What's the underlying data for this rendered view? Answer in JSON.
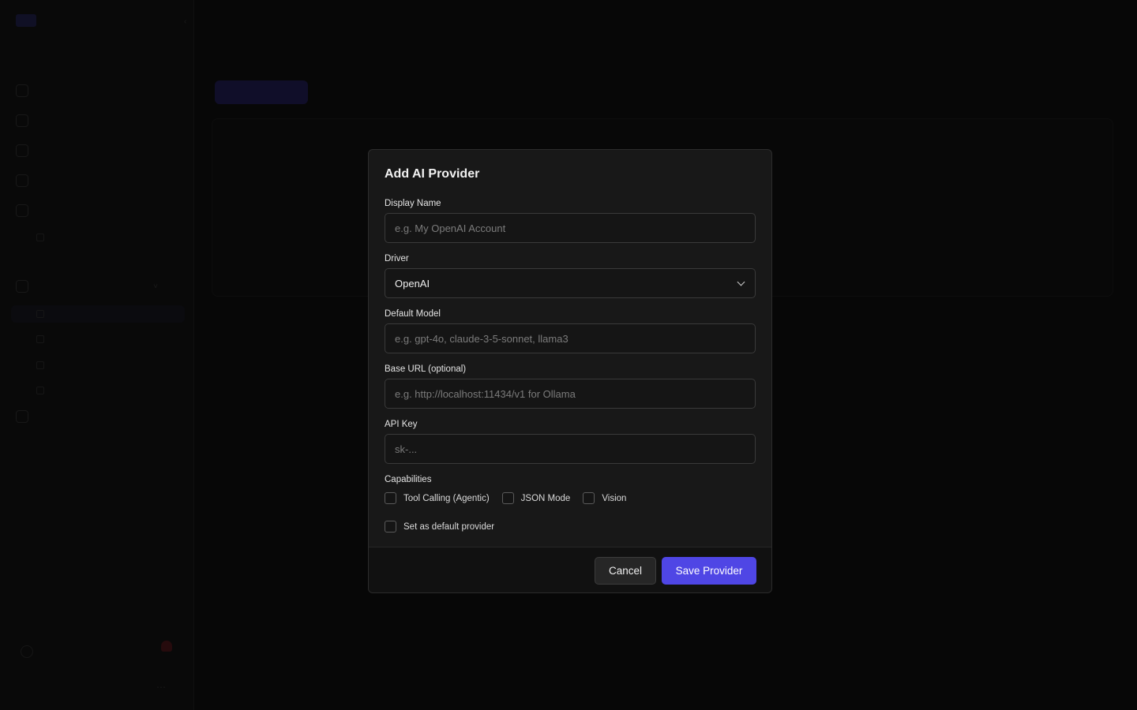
{
  "modal": {
    "title": "Add AI Provider",
    "fields": {
      "display_name": {
        "label": "Display Name",
        "placeholder": "e.g. My OpenAI Account"
      },
      "driver": {
        "label": "Driver",
        "value": "OpenAI"
      },
      "default_model": {
        "label": "Default Model",
        "placeholder": "e.g. gpt-4o, claude-3-5-sonnet, llama3"
      },
      "base_url": {
        "label": "Base URL (optional)",
        "placeholder": "e.g. http://localhost:11434/v1 for Ollama"
      },
      "api_key": {
        "label": "API Key",
        "placeholder": "sk-..."
      }
    },
    "capabilities": {
      "label": "Capabilities",
      "items": [
        {
          "label": "Tool Calling (Agentic)",
          "checked": false
        },
        {
          "label": "JSON Mode",
          "checked": false
        },
        {
          "label": "Vision",
          "checked": false
        }
      ]
    },
    "default_provider": {
      "label": "Set as default provider",
      "checked": false
    },
    "buttons": {
      "cancel": "Cancel",
      "save": "Save Provider"
    }
  },
  "colors": {
    "accent": "#4f46e5",
    "modal_bg": "#181818",
    "page_bg": "#0b0b0b"
  }
}
